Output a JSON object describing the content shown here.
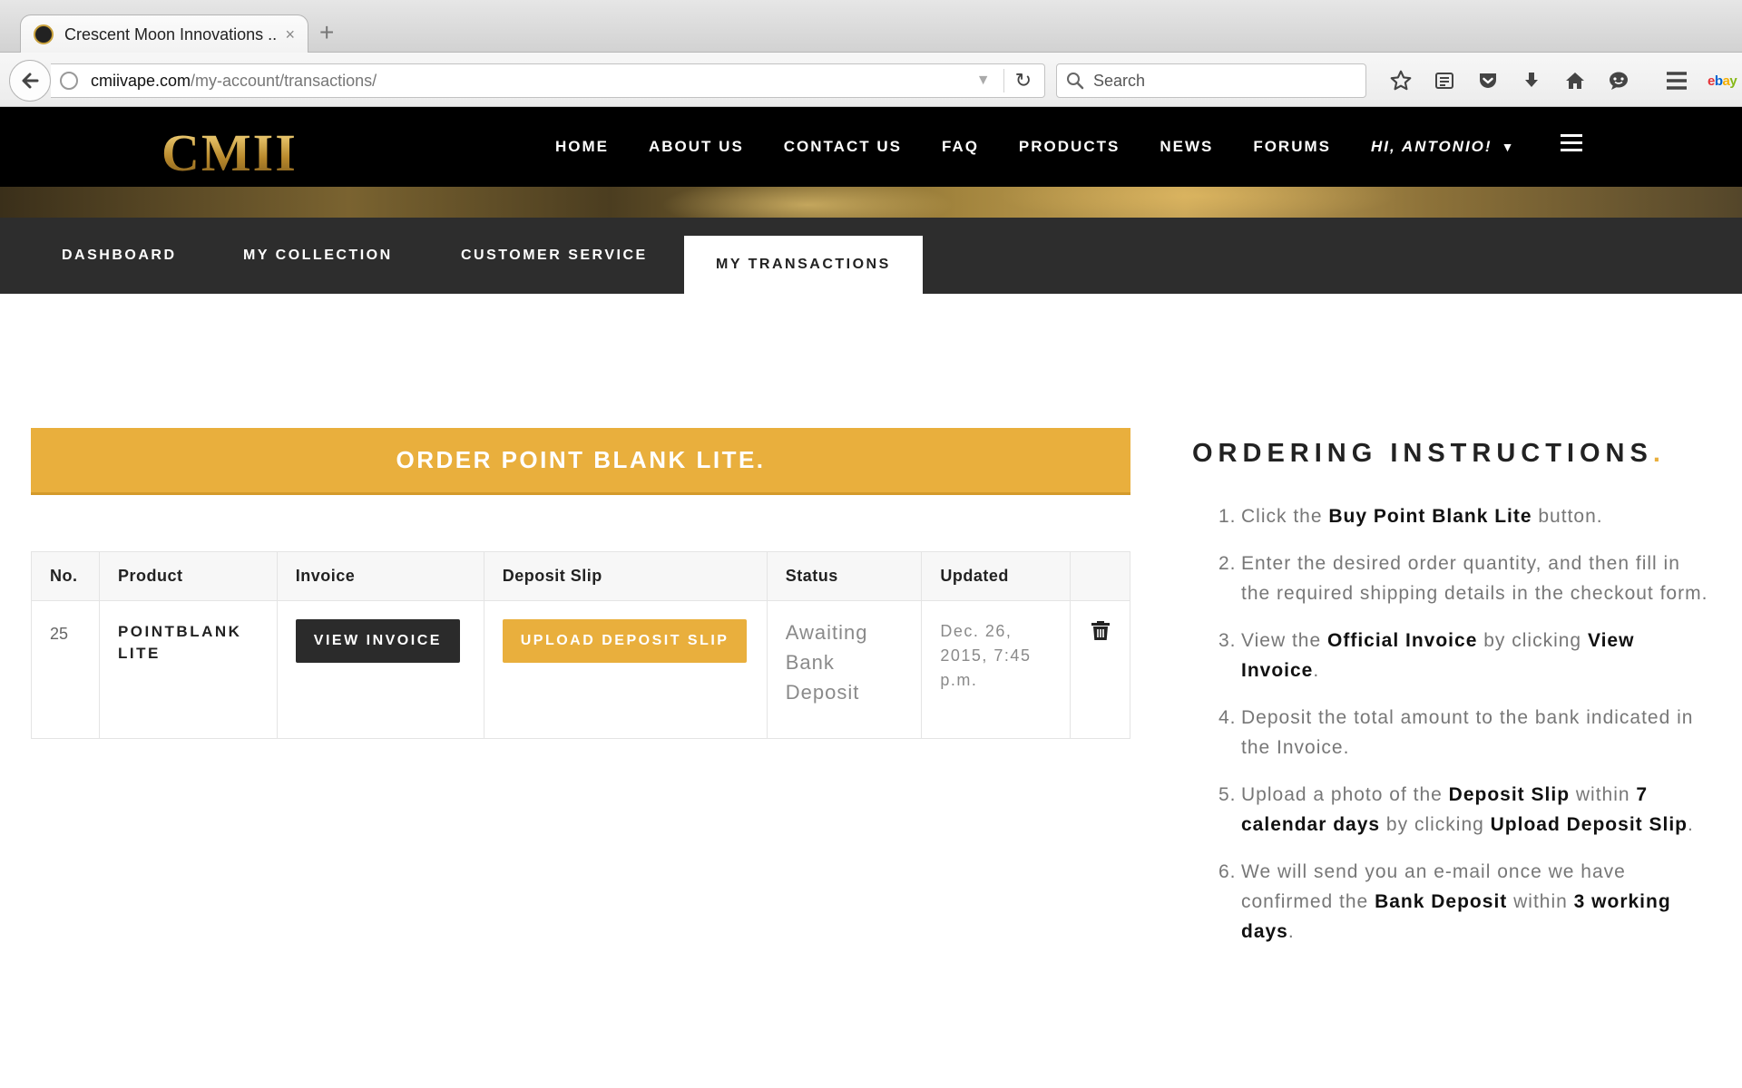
{
  "browser": {
    "tab_title": "Crescent Moon Innovations ...",
    "tab_close": "×",
    "new_tab": "+",
    "url_domain": "cmiivape.com",
    "url_path": "/my-account/transactions/",
    "search_placeholder": "Search",
    "toolbar_icons": [
      "star-icon",
      "reading-list-icon",
      "pocket-icon",
      "download-icon",
      "home-icon",
      "chat-icon",
      "menu-icon"
    ],
    "ebay": [
      "e",
      "b",
      "a",
      "y"
    ]
  },
  "site": {
    "logo": "CMII",
    "nav": [
      "HOME",
      "ABOUT US",
      "CONTACT US",
      "FAQ",
      "PRODUCTS",
      "NEWS",
      "FORUMS"
    ],
    "user_greeting": "HI, ANTONIO!",
    "user_caret": "▼",
    "accent": "#e9af3d"
  },
  "account_tabs": [
    "DASHBOARD",
    "MY COLLECTION",
    "CUSTOMER SERVICE",
    "MY TRANSACTIONS"
  ],
  "order_banner": "ORDER POINT BLANK LITE.",
  "table": {
    "headers": [
      "No.",
      "Product",
      "Invoice",
      "Deposit Slip",
      "Status",
      "Updated"
    ],
    "rows": [
      {
        "no": "25",
        "product_line1": "POINTBLANK",
        "product_line2": "LITE",
        "invoice_button": "VIEW INVOICE",
        "deposit_button": "UPLOAD DEPOSIT SLIP",
        "status_line1": "Awaiting",
        "status_line2": "Bank",
        "status_line3": "Deposit",
        "updated_line1": "Dec. 26,",
        "updated_line2": "2015, 7:45",
        "updated_line3": "p.m."
      }
    ]
  },
  "instructions": {
    "title": "ORDERING INSTRUCTIONS",
    "title_dot": ".",
    "steps": [
      {
        "n": "1.",
        "parts": [
          "Click the ",
          "Buy Point Blank Lite",
          " button."
        ]
      },
      {
        "n": "2.",
        "parts": [
          "Enter the desired order quantity, and then fill in the required shipping details in the checkout form."
        ]
      },
      {
        "n": "3.",
        "parts": [
          "View the ",
          "Official Invoice",
          " by clicking ",
          "View Invoice",
          "."
        ]
      },
      {
        "n": "4.",
        "parts": [
          "Deposit the total amount to the bank indicated in the Invoice."
        ]
      },
      {
        "n": "5.",
        "parts": [
          "Upload a photo of the ",
          "Deposit Slip",
          " within ",
          "7 calendar days",
          " by clicking ",
          "Upload Deposit Slip",
          "."
        ]
      },
      {
        "n": "6.",
        "parts": [
          "We will send you an e-mail once we have confirmed the ",
          "Bank Deposit",
          " within ",
          "3 working days",
          "."
        ]
      }
    ]
  }
}
